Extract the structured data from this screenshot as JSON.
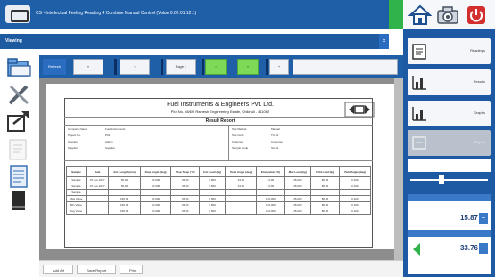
{
  "window": {
    "title": "CS - Intellectual Feeling Reading 4 Combine Manual Control (Value 0.02.01.12.1)"
  },
  "header": {
    "label": "Viewing",
    "close_label": "×"
  },
  "toolbar": {
    "buttons": [
      "Refresh",
      "«",
      "‹",
      "Page 1",
      "›",
      "»",
      "+"
    ]
  },
  "report": {
    "company": "Fuel Instruments & Engineers Pvt. Ltd.",
    "address": "Plot No. 68/69, Ramesh Engineering Estate, Chikhali - 411062",
    "name": "Result Report",
    "columns": [
      "Sample",
      "Date",
      "Init. Length (mm)",
      "Stop Angle (deg)",
      "Stop Temp (°C)",
      "Init. Load (kg)",
      "Peak Angle (deg)",
      "Elongation (%)",
      "Max Load (kg)",
      "Yield Load (kg)",
      "Yield Angle (deg)"
    ],
    "rows": [
      [
        "Sample",
        "07-Jun-2017",
        "50.00",
        "30.000",
        "25.00",
        "0.500",
        "13.00",
        "24.00",
        "45.000",
        "80.00",
        "0.100"
      ],
      [
        "Sample",
        "07-Jun-2017",
        "50.00",
        "30.000",
        "25.00",
        "0.500",
        "13.00",
        "24.00",
        "45.000",
        "80.00",
        "0.100"
      ],
      [
        "Sample",
        "",
        "",
        "",
        "",
        "",
        "",
        "",
        "",
        "",
        ""
      ],
      [
        "Max Value",
        "",
        "150.00",
        "30.000",
        "25.00",
        "0.500",
        "",
        "120.000",
        "45.000",
        "80.00",
        "0.100"
      ],
      [
        "Min Value",
        "",
        "150.00",
        "30.000",
        "25.00",
        "0.500",
        "",
        "120.000",
        "45.000",
        "80.00",
        "0.100"
      ],
      [
        "Avg Value",
        "",
        "150.00",
        "30.000",
        "25.00",
        "0.500",
        "",
        "120.000",
        "45.000",
        "80.00",
        "0.100"
      ]
    ],
    "info_labels": [
      "Company Name",
      "Project No.",
      "Operator",
      "Supplier",
      "Test Method",
      "Test Code",
      "Customer",
      "Sample Code"
    ],
    "info_values": [
      "Fuel Instruments",
      "P01",
      "Admin",
      "Supplier",
      "Manual",
      "TC-01",
      "Customer",
      "SC-01"
    ]
  },
  "statusbar": {
    "items": [
      "Add Art",
      "Save Report",
      "Print"
    ]
  },
  "right_panel": {
    "buttons": [
      "Readings",
      "Results",
      "Graphs",
      "Report"
    ],
    "meter1": {
      "value": "15.87",
      "button": "−"
    },
    "meter2": {
      "value": "33.76",
      "button": "−"
    }
  },
  "colors": {
    "primary": "#1f5fa8",
    "accent_green": "#2fb34a",
    "toolbar_green": "#7ed957",
    "power_red": "#d32f2f"
  }
}
